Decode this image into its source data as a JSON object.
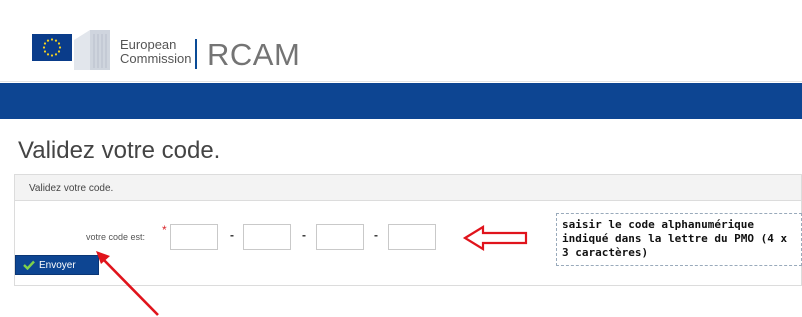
{
  "header": {
    "org_line1": "European",
    "org_line2": "Commission",
    "app_name": "RCAM"
  },
  "page": {
    "title": "Validez votre code."
  },
  "panel": {
    "heading": "Validez votre code.",
    "code_label": "votre code est:",
    "required_marker": "*",
    "separator": "-",
    "inputs": [
      {
        "value": "",
        "placeholder": ""
      },
      {
        "value": "",
        "placeholder": ""
      },
      {
        "value": "",
        "placeholder": ""
      },
      {
        "value": "",
        "placeholder": ""
      }
    ],
    "submit_label": "Envoyer"
  },
  "annotation": {
    "text": "saisir le code alphanumérique indiqué dans la lettre du PMO (4 x 3 caractères)"
  },
  "colors": {
    "brand_blue": "#0d4592",
    "annotation_red": "#e0141c",
    "required_red": "#d9262b"
  },
  "icons": [
    "eu-flag-icon",
    "check-icon",
    "left-arrow-callout-icon",
    "pointer-arrow-icon"
  ]
}
